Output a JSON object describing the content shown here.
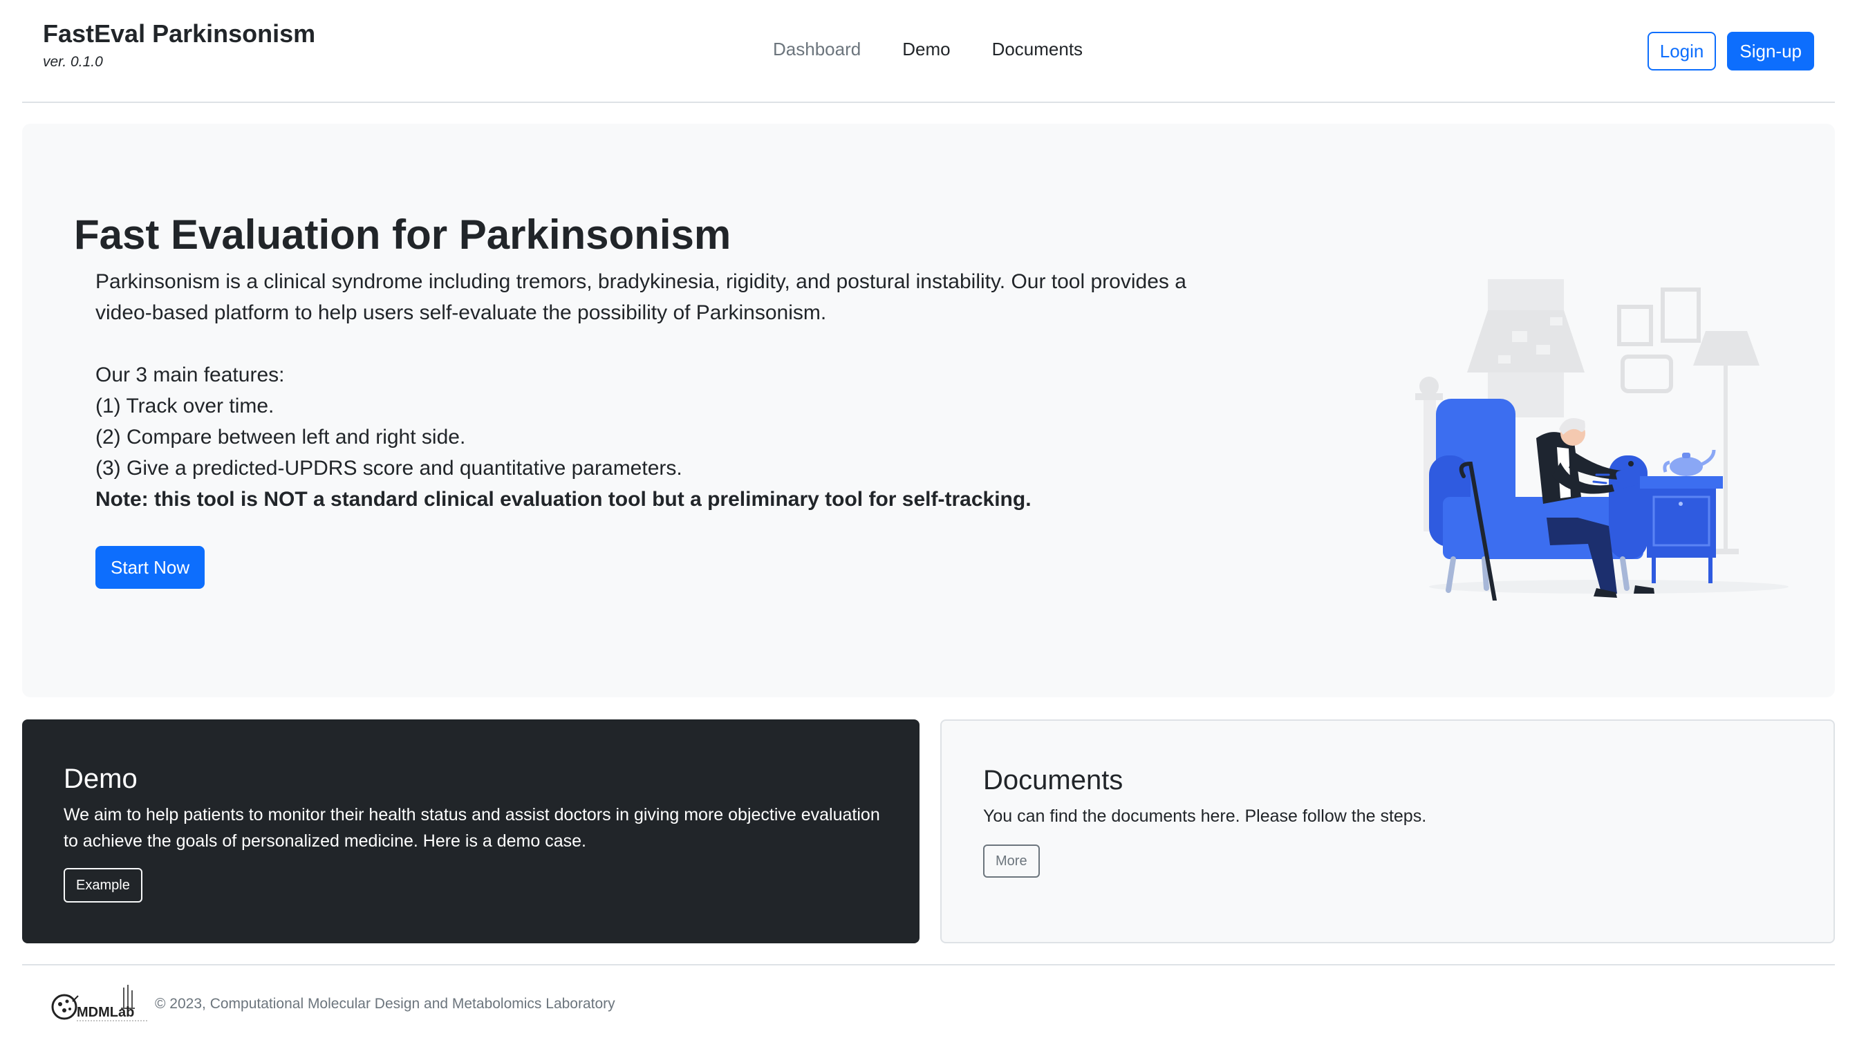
{
  "header": {
    "brand_title": "FastEval Parkinsonism",
    "version": "ver. 0.1.0",
    "nav": [
      {
        "label": "Dashboard"
      },
      {
        "label": "Demo"
      },
      {
        "label": "Documents"
      }
    ],
    "login_label": "Login",
    "signup_label": "Sign-up"
  },
  "hero": {
    "title": "Fast Evaluation for Parkinsonism",
    "description": "Parkinsonism is a clinical syndrome including tremors, bradykinesia, rigidity, and postural instability. Our tool provides a video-based platform to help users self-evaluate the possibility of Parkinsonism.",
    "features_heading": "Our 3 main features:",
    "features": [
      "(1) Track over time.",
      "(2) Compare between left and right side.",
      "(3) Give a predicted-UPDRS score and quantitative parameters."
    ],
    "note": "Note: this tool is NOT a standard clinical evaluation tool but a preliminary tool for self-tracking.",
    "start_label": "Start Now"
  },
  "cards": {
    "demo": {
      "title": "Demo",
      "text": "We aim to help patients to monitor their health status and assist doctors in giving more objective evaluation to achieve the goals of personalized medicine. Here is a demo case.",
      "button_label": "Example"
    },
    "documents": {
      "title": "Documents",
      "text": "You can find the documents here. Please follow the steps.",
      "button_label": "More"
    }
  },
  "footer": {
    "logo_text": "MDMLab",
    "copyright": "© 2023, Computational Molecular Design and Metabolomics Laboratory"
  },
  "colors": {
    "primary": "#0d6efd",
    "dark": "#212529",
    "light_bg": "#f8f9fa",
    "muted": "#6c757d",
    "border": "#dee2e6"
  }
}
